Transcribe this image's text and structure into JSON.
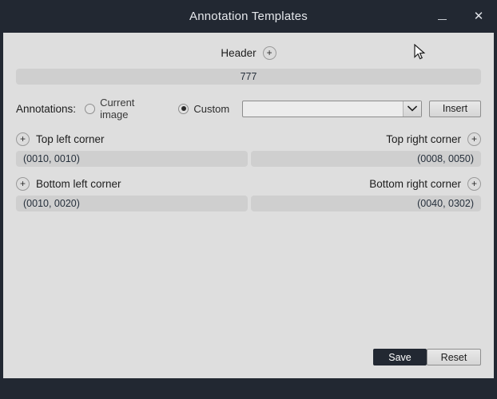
{
  "window": {
    "title": "Annotation Templates",
    "minimize_label": "—",
    "close_label": "✕",
    "titlebar_color": "#222832",
    "body_color": "#dedede"
  },
  "header": {
    "label": "Header",
    "add_button_label": "+",
    "value": "777"
  },
  "annotations": {
    "label": "Annotations:",
    "options": [
      {
        "label": "Current image",
        "selected": false
      },
      {
        "label": "Custom",
        "selected": true
      }
    ],
    "dropdown": {
      "value": "",
      "placeholder": "",
      "icon": "chevron-down-icon"
    },
    "insert_label": "Insert"
  },
  "corners": [
    {
      "key": "top_left",
      "label": "Top left corner",
      "add_button_label": "+",
      "value": "(0010, 0010)",
      "align": "left"
    },
    {
      "key": "top_right",
      "label": "Top right corner",
      "add_button_label": "+",
      "value": "(0008, 0050)",
      "align": "right"
    },
    {
      "key": "bottom_left",
      "label": "Bottom left corner",
      "add_button_label": "+",
      "value": "(0010, 0020)",
      "align": "left"
    },
    {
      "key": "bottom_right",
      "label": "Bottom right corner",
      "add_button_label": "+",
      "value": "(0040, 0302)",
      "align": "right"
    }
  ],
  "footer": {
    "save_label": "Save",
    "reset_label": "Reset",
    "save_color": "#222832"
  }
}
